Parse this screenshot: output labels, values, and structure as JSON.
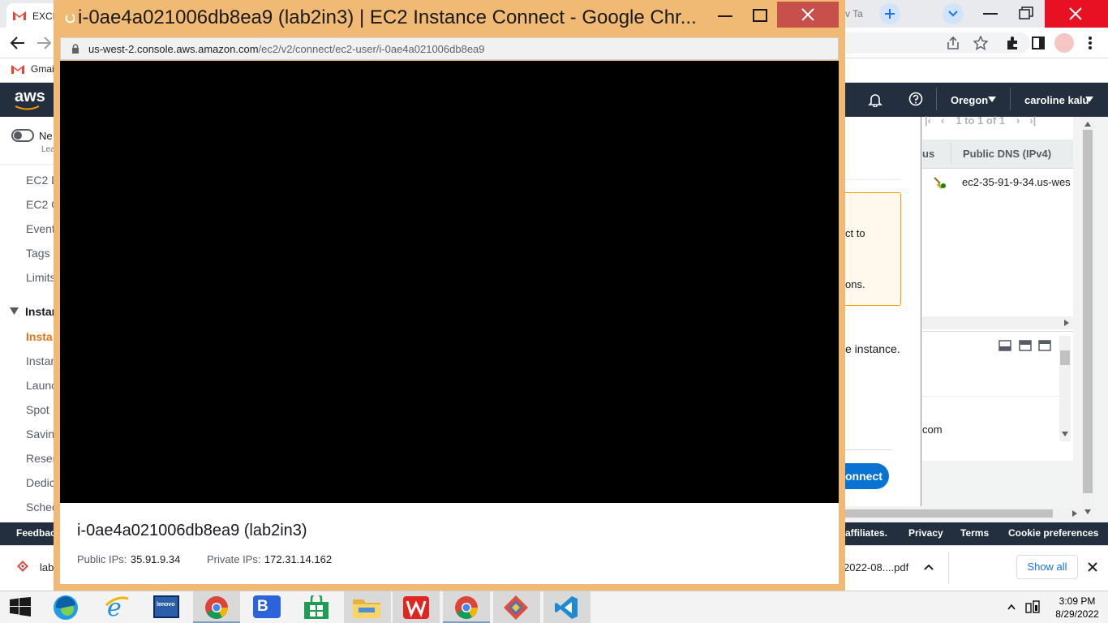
{
  "bg_browser": {
    "tabs": [
      {
        "title": "EXCE"
      },
      {
        "title": "v Ta"
      }
    ],
    "bookmark_gmail": "Gmai"
  },
  "aws": {
    "logo": "aws",
    "region": "Oregon",
    "user": "caroline kalu",
    "toggle_label": "Ne",
    "toggle_sub": "Lea",
    "sidebar": [
      {
        "label": "EC2 D"
      },
      {
        "label": "EC2 G"
      },
      {
        "label": "Event"
      },
      {
        "label": "Tags"
      },
      {
        "label": "Limits"
      },
      {
        "label": "Instan"
      },
      {
        "label": "Insta"
      },
      {
        "label": "Instan"
      },
      {
        "label": "Launc"
      },
      {
        "label": "Spot"
      },
      {
        "label": "Savin"
      },
      {
        "label": "Reser"
      },
      {
        "label": "Dedic"
      },
      {
        "label": "Schec"
      }
    ],
    "pagination": "1 to 1 of 1",
    "col_status_fragment": "us",
    "col_public_dns": "Public DNS (IPv4)",
    "dns_value": "ec2-35-91-9-34.us-wes",
    "warn_line1": "ct to",
    "warn_line2": "ons.",
    "instance_text": "e instance.",
    "detail_fragment": "com",
    "connect_label": "onnect",
    "footer": {
      "feedback": "Feedbac",
      "affiliates": "affiliates.",
      "privacy": "Privacy",
      "terms": "Terms",
      "cookies": "Cookie preferences"
    }
  },
  "downloads": {
    "left_item": "lab",
    "right_item": "2022-08....pdf",
    "show_all": "Show all"
  },
  "popup": {
    "title": "i-0ae4a021006db8ea9 (lab2in3) | EC2 Instance Connect - Google Chr...",
    "url_host": "us-west-2.console.aws.amazon.com",
    "url_path": "/ec2/v2/connect/ec2-user/i-0ae4a021006db8ea9",
    "instance_title": "i-0ae4a021006db8ea9 (lab2in3)",
    "public_ip_label": "Public IPs:",
    "public_ip_value": "35.91.9.34",
    "private_ip_label": "Private IPs:",
    "private_ip_value": "172.31.14.162"
  },
  "taskbar": {
    "time": "3:09 PM",
    "date": "8/29/2022",
    "apps": [
      "start-icon",
      "edge-icon",
      "ie-icon",
      "lenovo-icon",
      "chrome-icon",
      "bluejeans-icon",
      "store-icon",
      "file-explorer-icon",
      "wps-icon",
      "chrome-icon",
      "git-icon",
      "vscode-icon"
    ]
  },
  "colors": {
    "aws_nav": "#232f3e",
    "popup_frame": "#f0b974",
    "close_red": "#c7504b",
    "aws_link_blue": "#0972d3"
  }
}
